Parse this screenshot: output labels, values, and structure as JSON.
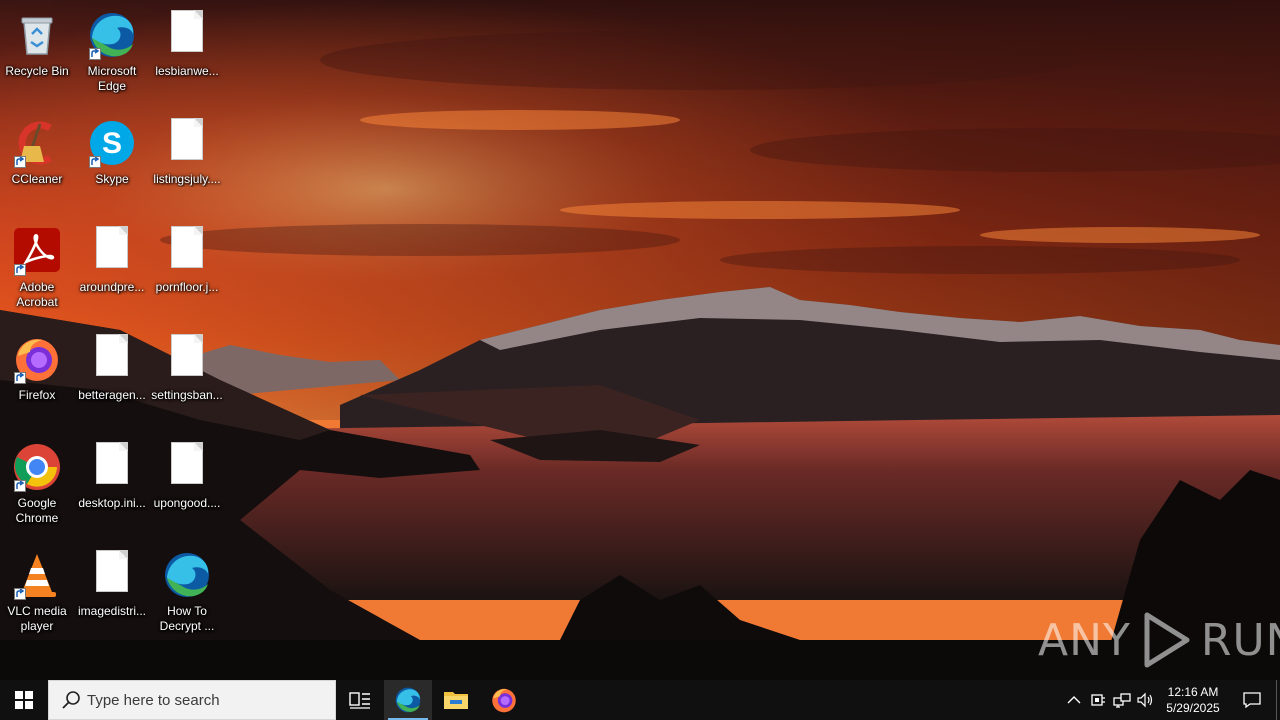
{
  "desktop": {
    "icons": [
      {
        "label": "Recycle Bin",
        "icon": "recycle-bin-icon"
      },
      {
        "label": "Microsoft Edge",
        "icon": "edge-icon"
      },
      {
        "label": "lesbianwe...",
        "icon": "document-icon"
      },
      {
        "label": "CCleaner",
        "icon": "ccleaner-icon"
      },
      {
        "label": "Skype",
        "icon": "skype-icon"
      },
      {
        "label": "listingsjuly....",
        "icon": "document-icon"
      },
      {
        "label": "Adobe Acrobat",
        "icon": "acrobat-icon"
      },
      {
        "label": "aroundpre...",
        "icon": "document-icon"
      },
      {
        "label": "pornfloor.j...",
        "icon": "document-icon"
      },
      {
        "label": "Firefox",
        "icon": "firefox-icon"
      },
      {
        "label": "betteragen...",
        "icon": "document-icon"
      },
      {
        "label": "settingsban...",
        "icon": "document-icon"
      },
      {
        "label": "Google Chrome",
        "icon": "chrome-icon"
      },
      {
        "label": "desktop.ini...",
        "icon": "document-icon"
      },
      {
        "label": "upongood....",
        "icon": "document-icon"
      },
      {
        "label": "VLC media player",
        "icon": "vlc-icon"
      },
      {
        "label": "imagedistri...",
        "icon": "document-icon"
      },
      {
        "label": "How To Decrypt ...",
        "icon": "edge-html-icon"
      }
    ]
  },
  "watermark": {
    "left": "ANY",
    "right": "RUN"
  },
  "taskbar": {
    "search_placeholder": "Type here to search",
    "pinned": [
      {
        "name": "Task View",
        "icon": "task-view-icon"
      },
      {
        "name": "Microsoft Edge",
        "icon": "edge-icon"
      },
      {
        "name": "File Explorer",
        "icon": "file-explorer-icon"
      },
      {
        "name": "Firefox",
        "icon": "firefox-icon"
      }
    ],
    "clock": {
      "time": "12:16 AM",
      "date": "5/29/2025"
    }
  },
  "colors": {
    "taskbar": "#101010",
    "search_box": "#f2f2f2",
    "accent": "#76b9ed",
    "sky_glow": "#e0491c"
  }
}
